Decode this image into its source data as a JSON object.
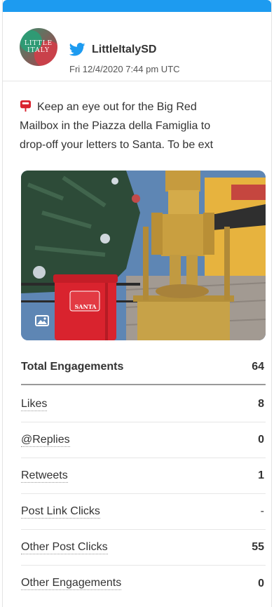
{
  "tweet": {
    "avatar_text": [
      "LITTLE",
      "ITALY"
    ],
    "handle": "LittleItalySD",
    "date": "Fri 12/4/2020 7:44 pm UTC",
    "text_lines": [
      "Keep an eye out for the Big Red",
      "Mailbox in the Piazza della Famiglia to",
      "drop-off your letters to Santa. To be ext"
    ],
    "mailbox_sign": "SANTA",
    "media_icon": "image-icon",
    "bird_icon": "twitter-bird-icon"
  },
  "metrics": [
    {
      "label": "Total Engagements",
      "value": "64"
    },
    {
      "label": "Likes",
      "value": "8"
    },
    {
      "label": "@Replies",
      "value": "0"
    },
    {
      "label": "Retweets",
      "value": "1"
    },
    {
      "label": "Post Link Clicks",
      "value": "-"
    },
    {
      "label": "Other Post Clicks",
      "value": "55"
    },
    {
      "label": "Other Engagements",
      "value": "0"
    }
  ],
  "colors": {
    "accent": "#1d9bf0",
    "mailbox_red": "#d9232e"
  }
}
